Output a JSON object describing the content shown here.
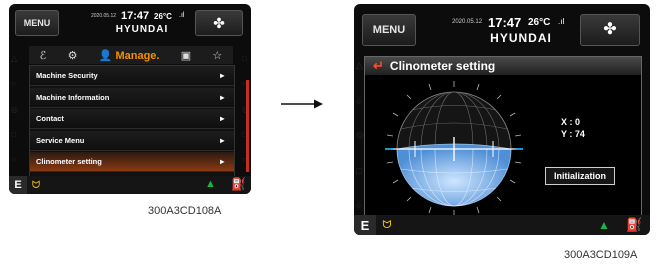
{
  "screen1": {
    "menu_label": "MENU",
    "date": "2020.05.12",
    "time": "17:47",
    "temp": "26°C",
    "brand": "HYUNDAI",
    "fan_icon": "fan-icon",
    "tab_active": "Manage.",
    "menu_items": [
      {
        "label": "Machine Security",
        "arrow": "►"
      },
      {
        "label": "Machine Information",
        "arrow": "►"
      },
      {
        "label": "Contact",
        "arrow": "►"
      },
      {
        "label": "Service Menu",
        "arrow": "►"
      },
      {
        "label": "Clinometer setting",
        "arrow": "►"
      }
    ],
    "gear": "E",
    "caption": "300A3CD108A"
  },
  "screen2": {
    "menu_label": "MENU",
    "date": "2020.05.12",
    "time": "17:47",
    "temp": "26°C",
    "brand": "HYUNDAI",
    "dialog_title": "Clinometer setting",
    "x_readout": "X : 0",
    "y_readout": "Y : 74",
    "init_label": "Initialization",
    "gear": "E",
    "caption": "300A3CD109A"
  },
  "colors": {
    "accent": "#f39200",
    "selected": "#8a3a12",
    "status_green": "#19b24b"
  }
}
